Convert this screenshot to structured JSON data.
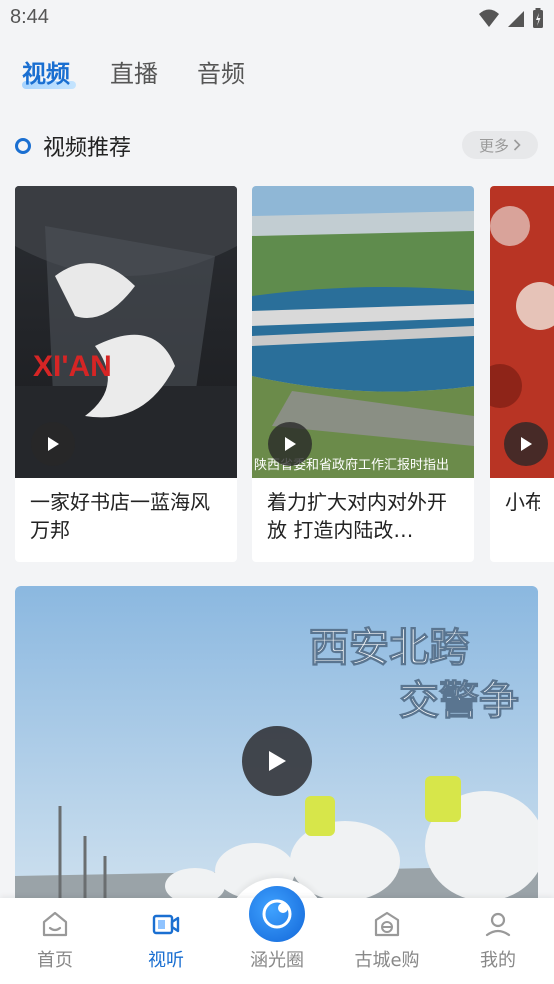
{
  "status": {
    "time": "8:44"
  },
  "tabs": [
    {
      "label": "视频"
    },
    {
      "label": "直播"
    },
    {
      "label": "音频"
    }
  ],
  "section": {
    "title": "视频推荐",
    "more_label": "更多"
  },
  "cards": [
    {
      "title": "一家好书店一蓝海风 万邦",
      "thumb_text": "XI'AN"
    },
    {
      "title": "着力扩大对内对外开放 打造内陆改…",
      "thumb_caption": "陕西省委和省政府工作汇报时指出"
    },
    {
      "title": "小布——"
    }
  ],
  "feature": {
    "caption_line1": "西安北跨",
    "caption_line2": "交警争"
  },
  "nav": [
    {
      "label": "首页",
      "icon": "home-icon"
    },
    {
      "label": "视听",
      "icon": "video-icon"
    },
    {
      "label": "涵光圈",
      "icon": "circle-icon"
    },
    {
      "label": "古城e购",
      "icon": "shop-icon"
    },
    {
      "label": "我的",
      "icon": "profile-icon"
    }
  ],
  "colors": {
    "accent": "#1a6fd1"
  }
}
